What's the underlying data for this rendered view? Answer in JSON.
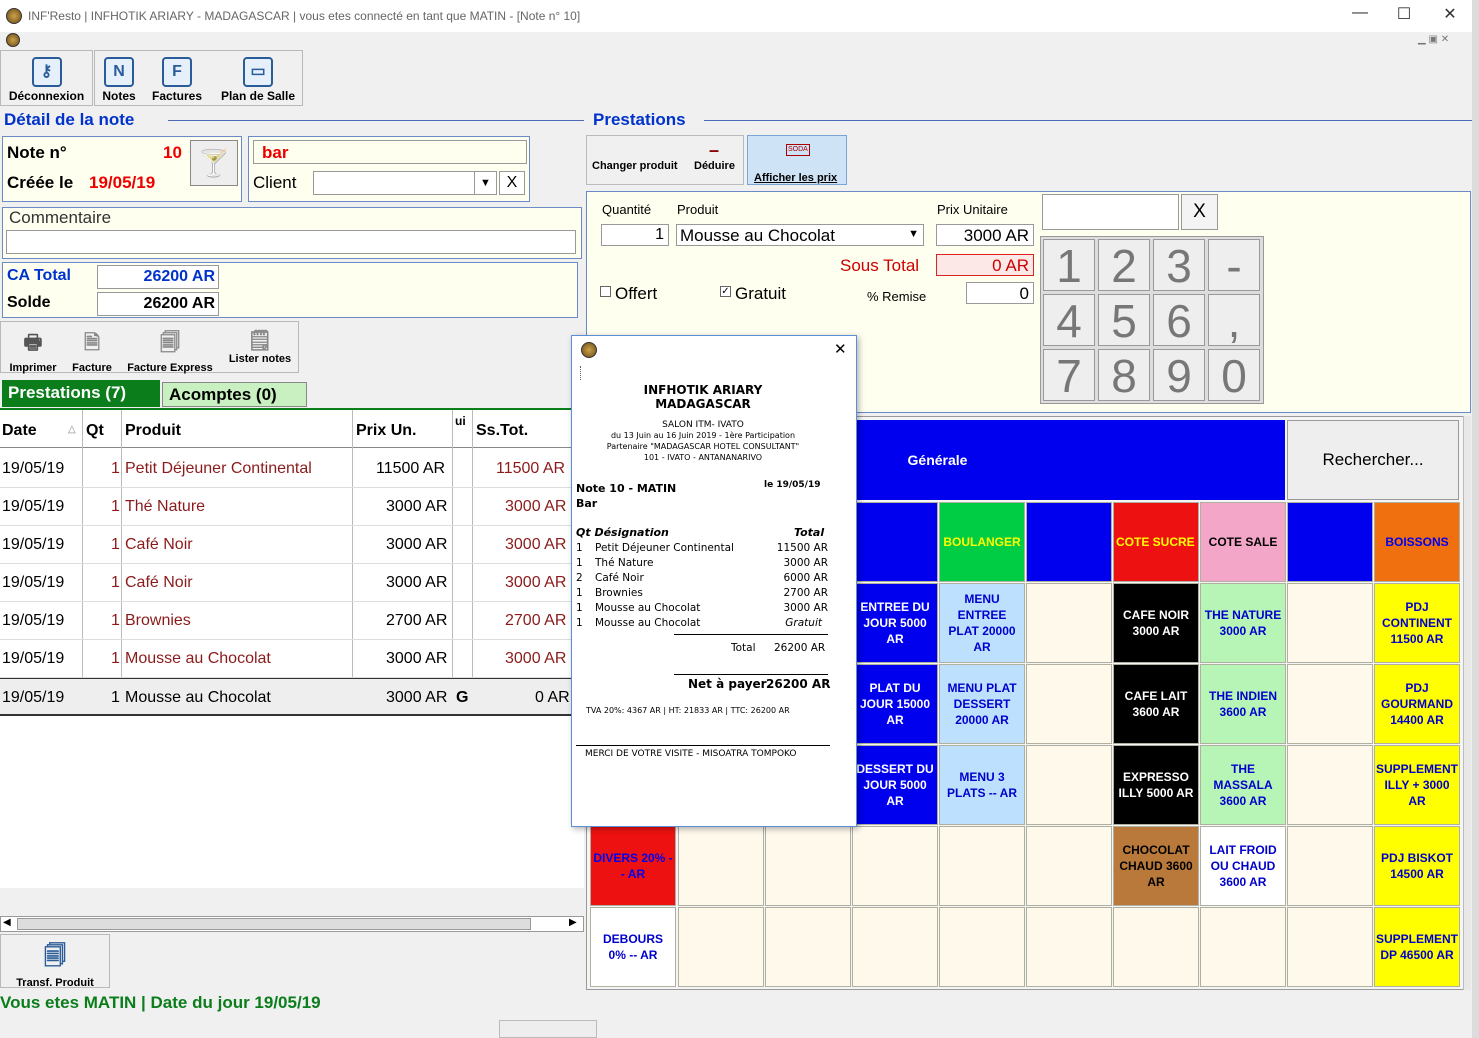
{
  "window": {
    "title": "INF'Resto | INFHOTIK ARIARY - MADAGASCAR | vous etes connecté en tant que MATIN - [Note n° 10]",
    "min": "—",
    "max": "☐",
    "close": "✕"
  },
  "toolbar": {
    "logout": "Déconnexion",
    "notes": "Notes",
    "invoices": "Factures",
    "floor": "Plan de Salle",
    "notes_icon": "N",
    "invoices_icon": "F"
  },
  "note": {
    "section": "Détail de la note",
    "num_label": "Note n°",
    "num": "10",
    "created_label": "Créée le",
    "created": "19/05/19",
    "place": "bar",
    "client_label": "Client",
    "comment_label": "Commentaire",
    "ca_label": "CA Total",
    "ca": "26200 AR",
    "solde_label": "Solde",
    "solde": "26200 AR"
  },
  "actions": {
    "print": "Imprimer",
    "invoice": "Facture",
    "express": "Facture Express",
    "list": "Lister notes",
    "transfer": "Transf. Produit"
  },
  "tabs": {
    "prestations": "Prestations (7)",
    "acomptes": "Acomptes (0)"
  },
  "table": {
    "headers": [
      "Date",
      "Qt",
      "Produit",
      "Prix Un.",
      "ui",
      "Ss.Tot."
    ],
    "rows": [
      [
        "19/05/19",
        "1",
        "Petit Déjeuner Continental",
        "11500 AR",
        "",
        "11500 AR"
      ],
      [
        "19/05/19",
        "1",
        "Thé Nature",
        "3000 AR",
        "",
        "3000 AR"
      ],
      [
        "19/05/19",
        "1",
        "Café Noir",
        "3000 AR",
        "",
        "3000 AR"
      ],
      [
        "19/05/19",
        "1",
        "Café Noir",
        "3000 AR",
        "",
        "3000 AR"
      ],
      [
        "19/05/19",
        "1",
        "Brownies",
        "2700 AR",
        "",
        "2700 AR"
      ],
      [
        "19/05/19",
        "1",
        "Mousse au Chocolat",
        "3000 AR",
        "",
        "3000 AR"
      ],
      [
        "19/05/19",
        "1",
        "Mousse au Chocolat",
        "3000 AR",
        "G",
        "0 AR"
      ]
    ]
  },
  "status": "Vous etes MATIN | Date du jour 19/05/19",
  "prest": {
    "section": "Prestations",
    "change": "Changer produit",
    "deduct": "Déduire",
    "prices": "Afficher les prix",
    "soda": "SODA",
    "qty_label": "Quantité",
    "qty": "1",
    "product_label": "Produit",
    "product": "Mousse au Chocolat",
    "unit_label": "Prix Unitaire",
    "unit": "3000 AR",
    "subtotal_label": "Sous Total",
    "subtotal": "0 AR",
    "offert": "Offert",
    "gratuit": "Gratuit",
    "remise_label": "% Remise",
    "remise": "0",
    "x": "X"
  },
  "keypad": [
    "1",
    "2",
    "3",
    "-",
    "4",
    "5",
    "6",
    ",",
    "7",
    "8",
    "9",
    "0"
  ],
  "categories": {
    "general": "Générale",
    "search": "Rechercher...",
    "boulanger": "BOULANGER",
    "cote_sucre": "COTE SUCRE",
    "cote_sale": "COTE SALE",
    "boissons": "BOISSONS"
  },
  "products": {
    "entree": "ENTREE DU JOUR 5000 AR",
    "menu_ep": "MENU ENTREE PLAT 20000 AR",
    "cafe_noir": "CAFE NOIR 3000 AR",
    "the_nature": "THE NATURE 3000 AR",
    "pdj_cont": "PDJ CONTINENT 11500 AR",
    "plat": "PLAT DU JOUR 15000 AR",
    "menu_pd": "MENU PLAT DESSERT 20000 AR",
    "cafe_lait": "CAFE LAIT 3600 AR",
    "the_indien": "THE INDIEN 3600 AR",
    "pdj_gour": "PDJ GOURMAND 14400 AR",
    "dessert": "DESSERT DU JOUR 5000 AR",
    "menu3": "MENU 3 PLATS -- AR",
    "expresso": "EXPRESSO ILLY 5000 AR",
    "the_massala": "THE MASSALA 3600 AR",
    "supp_illy": "SUPPLEMENT ILLY + 3000 AR",
    "divers": "DIVERS 20% -- AR",
    "chocolat": "CHOCOLAT CHAUD 3600 AR",
    "lait": "LAIT FROID OU CHAUD 3600 AR",
    "pdj_biskot": "PDJ BISKOT 14500 AR",
    "debours": "DEBOURS 0% -- AR",
    "supp_dp": "SUPPLEMENT DP 46500 AR"
  },
  "receipt": {
    "company1": "INFHOTIK ARIARY",
    "company2": "MADAGASCAR",
    "l1": "SALON ITM- IVATO",
    "l2": "du 13 Juin au 16 Juin 2019 - 1ère Participation",
    "l3": "Partenaire \"MADAGASCAR HOTEL CONSULTANT\"",
    "l4": "101 - IVATO - ANTANANARIVO",
    "note": "Note 10  -  MATIN",
    "date": "le 19/05/19",
    "place": "Bar",
    "h_qt": "Qt Désignation",
    "h_total": "Total",
    "lines": [
      [
        "1",
        "Petit Déjeuner Continental",
        "11500 AR"
      ],
      [
        "1",
        "Thé Nature",
        "3000 AR"
      ],
      [
        "2",
        "Café Noir",
        "6000 AR"
      ],
      [
        "1",
        "Brownies",
        "2700 AR"
      ],
      [
        "1",
        "Mousse au Chocolat",
        "3000 AR"
      ],
      [
        "1",
        "Mousse au Chocolat",
        "Gratuit"
      ]
    ],
    "total_label": "Total",
    "total": "26200 AR",
    "net_label": "Net à payer",
    "net": "26200 AR",
    "tva": "TVA 20%: 4367 AR | HT: 21833 AR | TTC: 26200 AR",
    "thanks": "MERCI DE VOTRE VISITE - MISOATRA TOMPOKO",
    "close": "✕"
  }
}
